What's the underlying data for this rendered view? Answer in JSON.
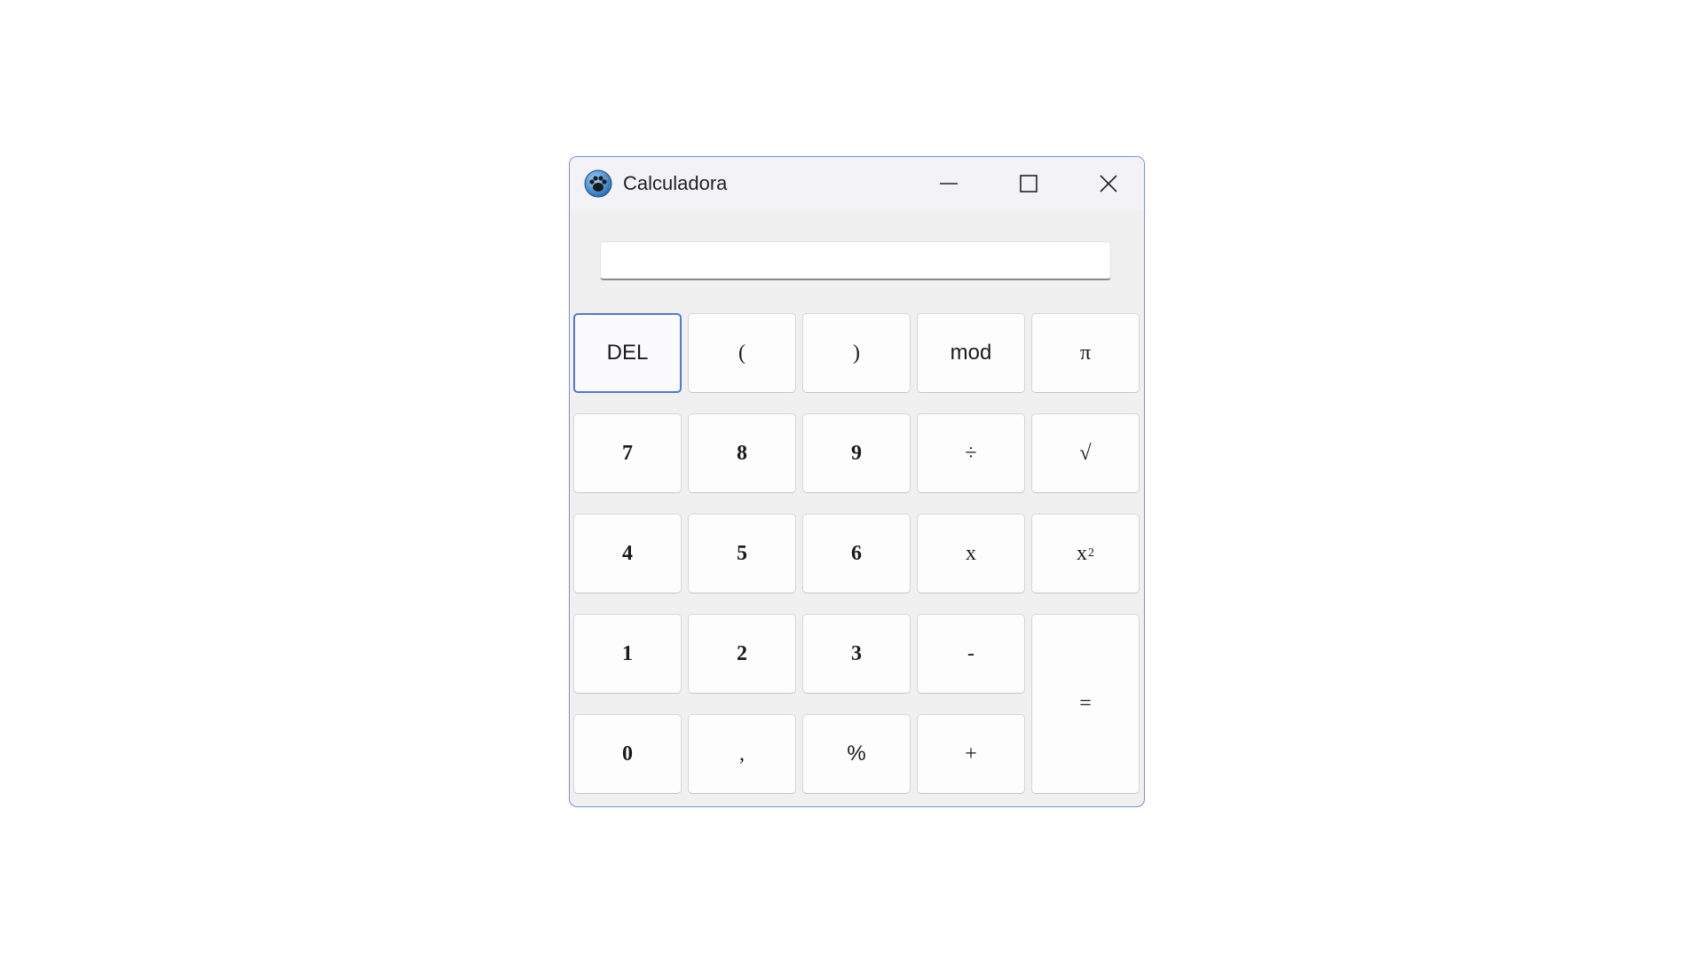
{
  "window": {
    "title": "Calculadora",
    "icon": "paw-icon",
    "controls": [
      "minimize-icon",
      "maximize-icon",
      "close-icon"
    ],
    "accent": "#4f78d6"
  },
  "display": {
    "value": ""
  },
  "keys": {
    "del": "DEL",
    "paren_open": "(",
    "paren_close": ")",
    "mod": "mod",
    "pi": "π",
    "seven": "7",
    "eight": "8",
    "nine": "9",
    "divide": "÷",
    "sqrt": "√",
    "four": "4",
    "five": "5",
    "six": "6",
    "multiply": "x",
    "square_base": "x",
    "square_exp": "2",
    "one": "1",
    "two": "2",
    "three": "3",
    "minus": "-",
    "equals": "=",
    "zero": "0",
    "comma": ",",
    "percent": "%",
    "plus": "+"
  }
}
